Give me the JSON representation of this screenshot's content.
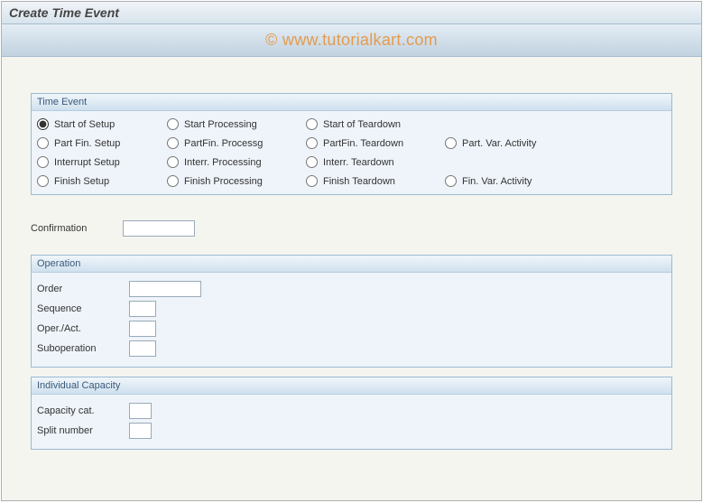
{
  "header": {
    "title": "Create Time Event",
    "watermark": "© www.tutorialkart.com"
  },
  "time_event": {
    "group_title": "Time Event",
    "options": {
      "r0c0": "Start of Setup",
      "r0c1": "Start Processing",
      "r0c2": "Start of Teardown",
      "r1c0": "Part Fin. Setup",
      "r1c1": "PartFin. Processg",
      "r1c2": "PartFin. Teardown",
      "r1c3": "Part. Var. Activity",
      "r2c0": "Interrupt Setup",
      "r2c1": "Interr. Processing",
      "r2c2": "Interr. Teardown",
      "r3c0": "Finish Setup",
      "r3c1": "Finish Processing",
      "r3c2": "Finish Teardown",
      "r3c3": "Fin. Var. Activity"
    },
    "selected": "r0c0"
  },
  "confirmation": {
    "label": "Confirmation",
    "value": ""
  },
  "operation": {
    "group_title": "Operation",
    "order": {
      "label": "Order",
      "value": ""
    },
    "sequence": {
      "label": "Sequence",
      "value": ""
    },
    "oper_act": {
      "label": "Oper./Act.",
      "value": ""
    },
    "suboperation": {
      "label": "Suboperation",
      "value": ""
    }
  },
  "capacity": {
    "group_title": "Individual Capacity",
    "capacity_cat": {
      "label": "Capacity cat.",
      "value": ""
    },
    "split_number": {
      "label": "Split number",
      "value": ""
    }
  }
}
